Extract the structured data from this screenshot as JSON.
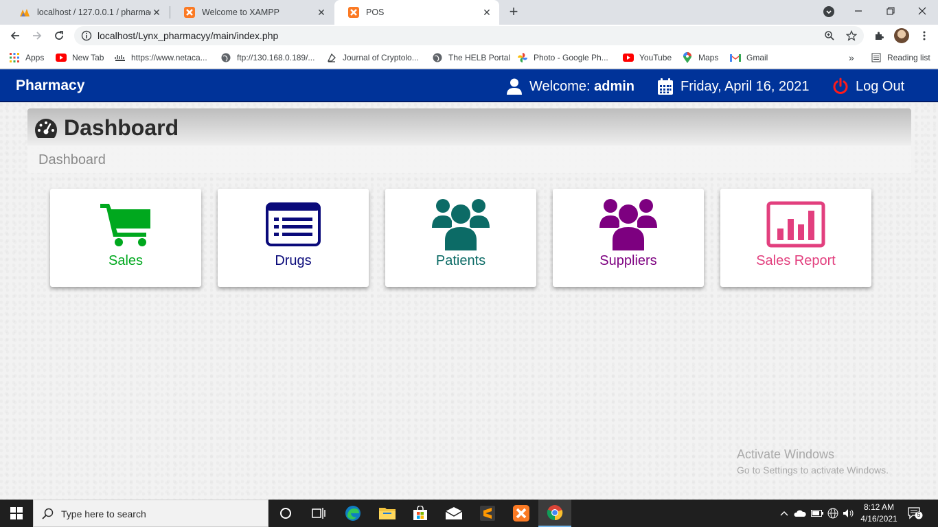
{
  "browser": {
    "tabs": [
      {
        "title": "localhost / 127.0.0.1 / pharmacy",
        "active": false
      },
      {
        "title": "Welcome to XAMPP",
        "active": false
      },
      {
        "title": "POS",
        "active": true
      }
    ],
    "url": "localhost/Lynx_pharmacyy/main/index.php",
    "bookmarks": [
      {
        "label": "Apps",
        "icon": "apps-grid-icon"
      },
      {
        "label": "New Tab",
        "icon": "youtube-icon"
      },
      {
        "label": "https://www.netaca...",
        "icon": "cisco-icon"
      },
      {
        "label": "ftp://130.168.0.189/...",
        "icon": "globe-icon"
      },
      {
        "label": "Journal of Cryptolo...",
        "icon": "journal-icon"
      },
      {
        "label": "The HELB Portal",
        "icon": "globe-icon"
      },
      {
        "label": "Photo - Google Ph...",
        "icon": "google-photos-icon"
      },
      {
        "label": "YouTube",
        "icon": "youtube-icon"
      },
      {
        "label": "Maps",
        "icon": "maps-icon"
      },
      {
        "label": "Gmail",
        "icon": "gmail-icon"
      }
    ],
    "overflow": "»",
    "reading_list": "Reading list"
  },
  "app": {
    "brand": "Pharmacy",
    "welcome_prefix": "Welcome: ",
    "username": "admin",
    "date": "Friday, April 16, 2021",
    "logout": "Log Out",
    "header_color": "#003399"
  },
  "page": {
    "title": "Dashboard",
    "breadcrumb": "Dashboard"
  },
  "tiles": [
    {
      "label": "Sales",
      "icon": "cart-icon",
      "color": "#00a81e"
    },
    {
      "label": "Drugs",
      "icon": "list-icon",
      "color": "#0a0a7a"
    },
    {
      "label": "Patients",
      "icon": "users-icon",
      "color": "#0c6b66"
    },
    {
      "label": "Suppliers",
      "icon": "users-icon",
      "color": "#7d0080"
    },
    {
      "label": "Sales Report",
      "icon": "bar-chart-icon",
      "color": "#e23f7e"
    }
  ],
  "watermark": {
    "line1": "Activate Windows",
    "line2": "Go to Settings to activate Windows."
  },
  "taskbar": {
    "search_placeholder": "Type here to search",
    "time": "8:12 AM",
    "date": "4/16/2021",
    "notifications": "5"
  }
}
